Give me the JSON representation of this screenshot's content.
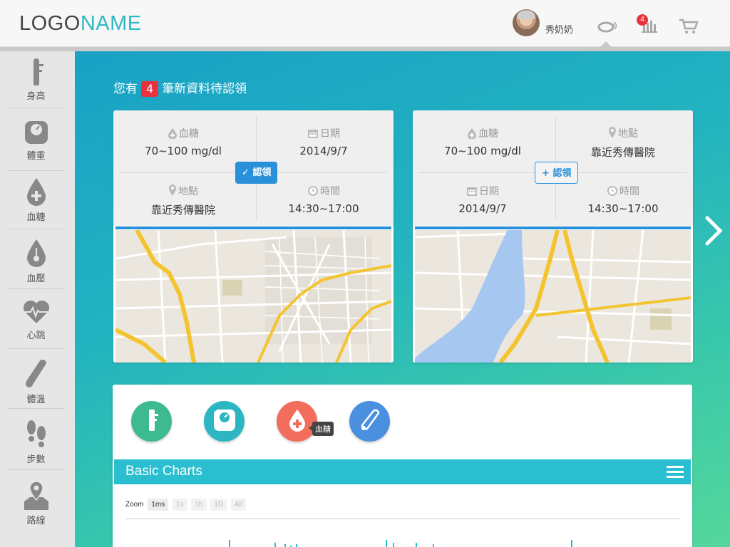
{
  "header": {
    "logo_part1": "LOGO",
    "logo_part2": "NAME",
    "username": "秀奶奶",
    "notif_count": "4"
  },
  "sidebar": {
    "items": [
      {
        "label": "身高",
        "icon": "height-ruler-icon"
      },
      {
        "label": "體重",
        "icon": "scale-icon"
      },
      {
        "label": "血糖",
        "icon": "blood-drop-plus-icon"
      },
      {
        "label": "血壓",
        "icon": "blood-pressure-icon"
      },
      {
        "label": "心跳",
        "icon": "heartbeat-icon"
      },
      {
        "label": "體溫",
        "icon": "thermometer-icon"
      },
      {
        "label": "步數",
        "icon": "footsteps-icon"
      },
      {
        "label": "路線",
        "icon": "route-map-icon"
      }
    ]
  },
  "notice": {
    "prefix": "您有",
    "count": "4",
    "suffix": "筆新資料待認領"
  },
  "cards": [
    {
      "cells": [
        {
          "key": "血糖",
          "value": "70~100 mg/dl",
          "icon": "blood-drop-icon"
        },
        {
          "key": "日期",
          "value": "2014/9/7",
          "icon": "calendar-icon"
        },
        {
          "key": "地點",
          "value": "靠近秀傳醫院",
          "icon": "location-pin-icon"
        },
        {
          "key": "時間",
          "value": "14:30~17:00",
          "icon": "clock-icon"
        }
      ],
      "claim_label": "認領",
      "claim_state": "claimed"
    },
    {
      "cells": [
        {
          "key": "血糖",
          "value": "70~100 mg/dl",
          "icon": "blood-drop-icon"
        },
        {
          "key": "地點",
          "value": "靠近秀傳醫院",
          "icon": "location-pin-icon"
        },
        {
          "key": "日期",
          "value": "2014/9/7",
          "icon": "calendar-icon"
        },
        {
          "key": "時間",
          "value": "14:30~17:00",
          "icon": "clock-icon"
        }
      ],
      "claim_label": "認領",
      "claim_state": "unclaimed"
    }
  ],
  "panel": {
    "tooltip": "血糖",
    "chart_title": "Basic Charts",
    "zoom_label": "Zoom",
    "zoom_options": [
      "1ms",
      "1s",
      "1h",
      "1D",
      "All"
    ],
    "zoom_active": "1ms"
  },
  "colors": {
    "accent": "#29bfd0",
    "claim_blue": "#2990d9",
    "badge_red": "#e8333f",
    "circle_green": "#3dba8f",
    "circle_teal": "#2cb6c4",
    "circle_coral": "#f26d5b",
    "circle_blue": "#4a8fe0"
  }
}
